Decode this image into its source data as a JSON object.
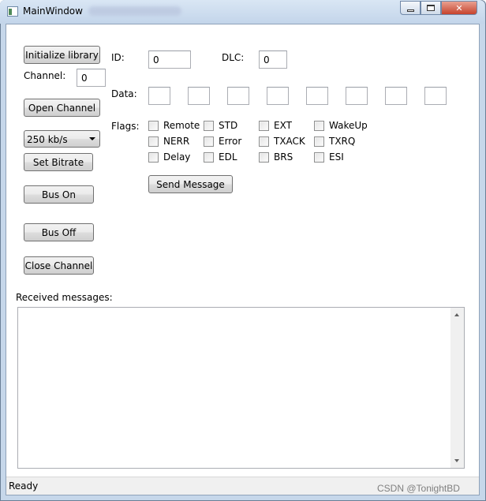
{
  "window": {
    "title": "MainWindow"
  },
  "left_panel": {
    "init_button": "Initialize library",
    "channel_label": "Channel:",
    "channel_value": "0",
    "open_button": "Open Channel",
    "bitrate_selected": "250 kb/s",
    "set_bitrate_button": "Set Bitrate",
    "bus_on_button": "Bus On",
    "bus_off_button": "Bus Off",
    "close_button": "Close Channel"
  },
  "message": {
    "id_label": "ID:",
    "id_value": "0",
    "dlc_label": "DLC:",
    "dlc_value": "0",
    "data_label": "Data:",
    "data_bytes": [
      "",
      "",
      "",
      "",
      "",
      "",
      "",
      ""
    ],
    "flags_label": "Flags:",
    "flags": [
      "Remote",
      "STD",
      "EXT",
      "WakeUp",
      "NERR",
      "Error",
      "TXACK",
      "TXRQ",
      "Delay",
      "EDL",
      "BRS",
      "ESI"
    ],
    "send_button": "Send Message"
  },
  "received": {
    "label": "Received messages:"
  },
  "status": {
    "text": "Ready"
  },
  "watermark": "CSDN @TonightBD"
}
